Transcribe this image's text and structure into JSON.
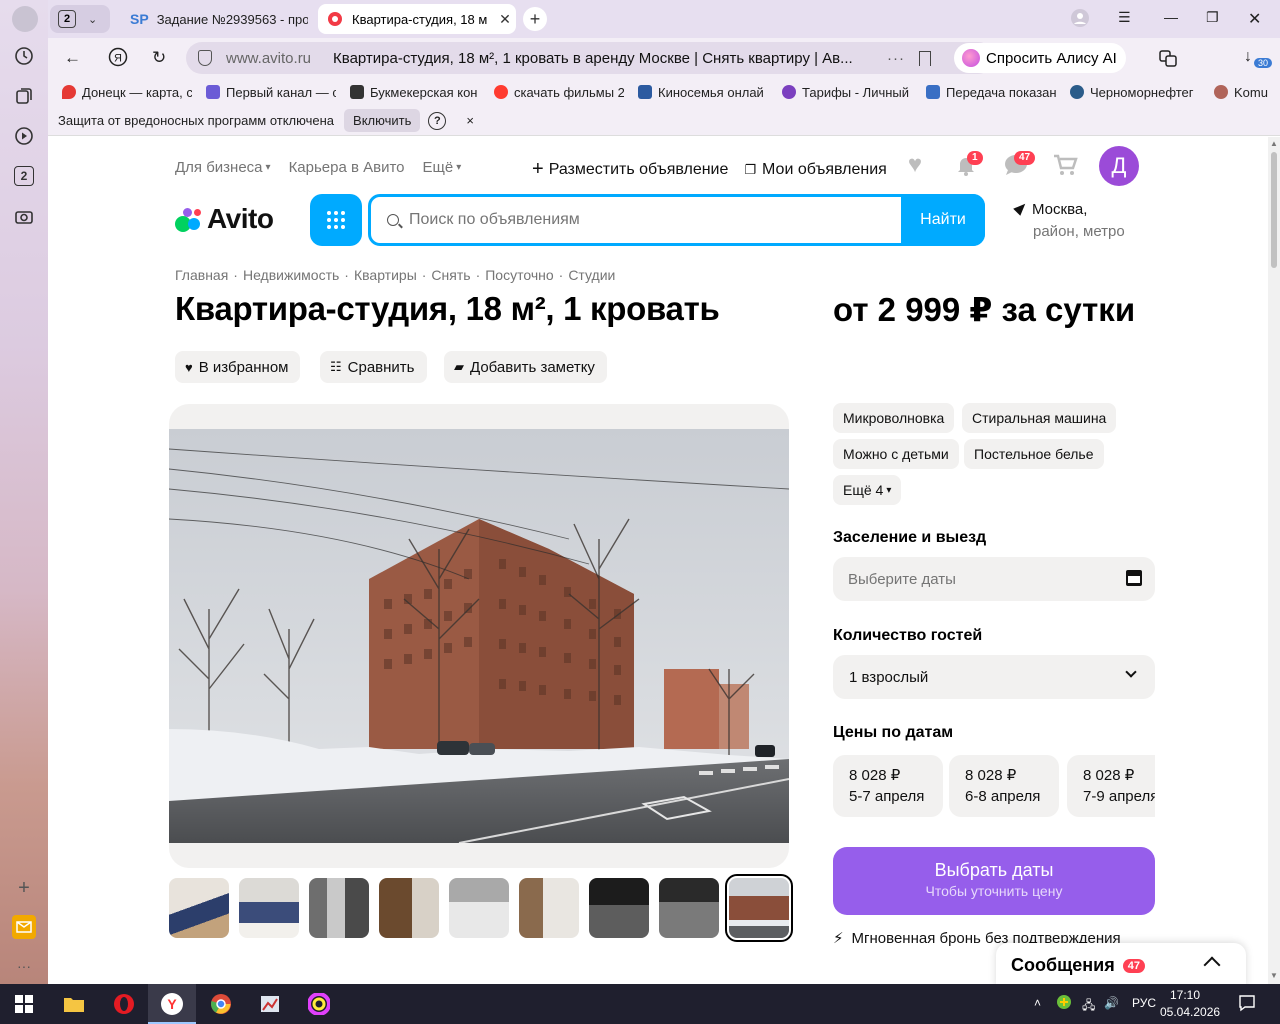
{
  "browser": {
    "tab_count": "2",
    "tabs": [
      {
        "favicon_text": "SP",
        "title": "Задание №2939563 - про"
      },
      {
        "title": "Квартира-студия, 18 м"
      }
    ],
    "address": {
      "host": "www.avito.ru",
      "page_title": "Квартира-студия, 18 м², 1 кровать в аренду Москве | Снять квартиру | Ав...",
      "dots": "···"
    },
    "alice_label": "Спросить Алису AI",
    "downloads_count": "30",
    "bookmarks": [
      {
        "label": "Донецк — карта, с",
        "color": "#e53935"
      },
      {
        "label": "Первый канал — с",
        "color": "#6b5bd6"
      },
      {
        "label": "Букмекерская кон",
        "color": "#333333"
      },
      {
        "label": "скачать фильмы 2",
        "color": "#ff3b30"
      },
      {
        "label": "Киносемья онлай",
        "color": "#2c5aa0"
      },
      {
        "label": "Тарифы - Личный",
        "color": "#7b3fbf"
      },
      {
        "label": "Передача показан",
        "color": "#3a6fc4"
      },
      {
        "label": "Черноморнефтег",
        "color": "#2b5c8a"
      },
      {
        "label": "Komu",
        "color": "#b0645a"
      }
    ],
    "infobar": {
      "text": "Защита от вредоносных программ отключена",
      "enable_label": "Включить",
      "help": "?",
      "close": "×"
    },
    "sidebar_badge": "2"
  },
  "avito": {
    "toplinks": [
      "Для бизнеса",
      "Карьера в Авито",
      "Ещё"
    ],
    "post_ad": "Разместить объявление",
    "my_ads": "Мои объявления",
    "notif_count": "1",
    "msg_count": "47",
    "avatar_letter": "Д",
    "logo": "Avito",
    "search": {
      "placeholder": "Поиск по объявлениям",
      "button": "Найти"
    },
    "location": {
      "city": "Москва,",
      "sub": "район, метро"
    },
    "breadcrumbs": [
      "Главная",
      "·",
      "Недвижимость",
      "·",
      "Квартиры",
      "·",
      "Снять",
      "·",
      "Посуточно",
      "·",
      "Студии"
    ],
    "title": "Квартира-студия, 18 м², 1 кровать",
    "price": "от 2 999 ₽ за сутки",
    "actions": {
      "favorite": "В избранном",
      "compare": "Сравнить",
      "note": "Добавить заметку"
    },
    "amenities": [
      "Микроволновка",
      "Стиральная машина",
      "Можно с детьми",
      "Постельное белье"
    ],
    "more_amenities": "Ещё 4",
    "checkin": {
      "label": "Заселение и выезд",
      "placeholder": "Выберите даты"
    },
    "guests": {
      "label": "Количество гостей",
      "value": "1 взрослый"
    },
    "date_prices": {
      "label": "Цены по датам",
      "cards": [
        {
          "price": "8 028 ₽",
          "dates": "5-7 апреля"
        },
        {
          "price": "8 028 ₽",
          "dates": "6-8 апреля"
        },
        {
          "price": "8 028 ₽",
          "dates": "7-9 апреля"
        }
      ]
    },
    "cta": {
      "title": "Выбрать даты",
      "subtitle": "Чтобы уточнить цену"
    },
    "instant": "Мгновенная бронь без подтверждения",
    "messages_widget": {
      "label": "Сообщения",
      "count": "47"
    },
    "thumbnails": [
      "kitchen",
      "kitchen-2",
      "shower",
      "bathroom",
      "toilet",
      "hallway",
      "corridor",
      "corridor-2",
      "building"
    ]
  },
  "taskbar": {
    "lang": "РУС",
    "time": "17:10",
    "date": "05.04.2026"
  },
  "colors": {
    "avito_blue": "#00aaff",
    "avito_purple": "#965eeb",
    "badge_red": "#ff4053"
  }
}
